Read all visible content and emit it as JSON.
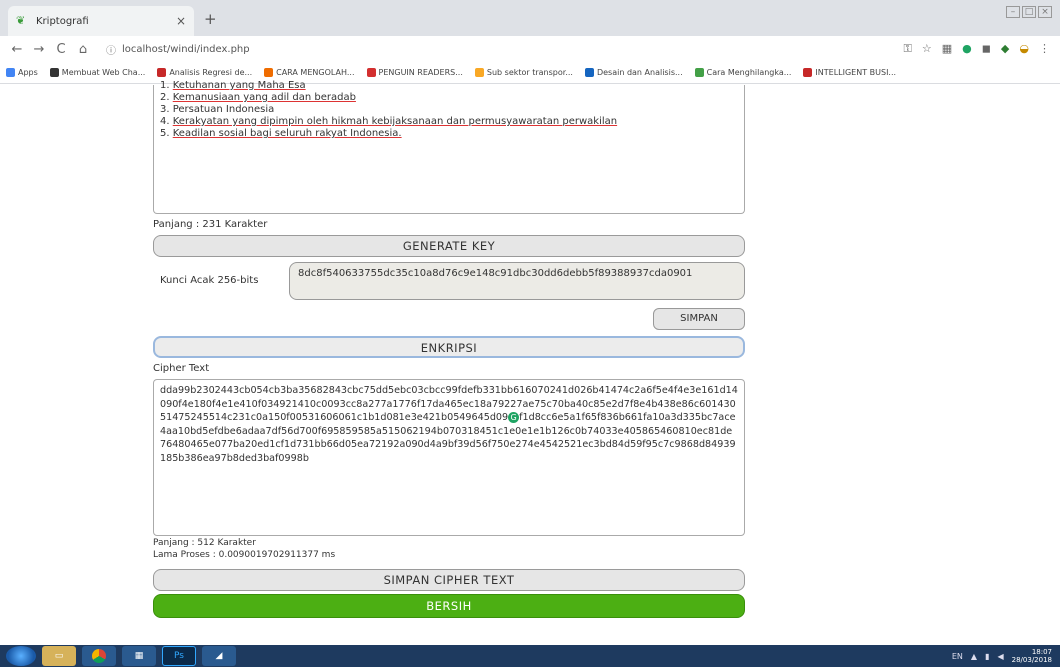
{
  "browser": {
    "tab_title": "Kriptografi",
    "tab_close": "×",
    "new_tab": "+",
    "url": "localhost/windi/index.php",
    "bookmarks": [
      {
        "label": "Apps",
        "color": "#4285f4"
      },
      {
        "label": "Membuat Web Cha...",
        "color": "#333333"
      },
      {
        "label": "Analisis Regresi de...",
        "color": "#c62828"
      },
      {
        "label": "CARA MENGOLAH...",
        "color": "#ef6c00"
      },
      {
        "label": "PENGUIN READERS...",
        "color": "#d32f2f"
      },
      {
        "label": "Sub sektor transpor...",
        "color": "#f9a825"
      },
      {
        "label": "Desain dan Analisis...",
        "color": "#1565c0"
      },
      {
        "label": "Cara Menghilangka...",
        "color": "#43a047"
      },
      {
        "label": "INTELLIGENT BUSI...",
        "color": "#c62828"
      }
    ]
  },
  "plaintext": {
    "lines": [
      {
        "prefix": "1. ",
        "text": "Ketuhanan yang Maha Esa"
      },
      {
        "prefix": "2. ",
        "text": "Kemanusiaan yang adil dan beradab"
      },
      {
        "prefix": "3. ",
        "text": "Persatuan Indonesia"
      },
      {
        "prefix": "4. ",
        "text": "Kerakyatan yang dipimpin oleh hikmah kebijaksanaan dan permusyawaratan perwakilan"
      },
      {
        "prefix": "5. ",
        "text": "Keadilan sosial bagi seluruh rakyat Indonesia."
      }
    ],
    "length_label": "Panjang : 231 Karakter"
  },
  "key": {
    "generate_label": "GENERATE KEY",
    "random_key_label": "Kunci Acak 256-bits",
    "value": "8dc8f540633755dc35c10a8d76c9e148c91dbc30dd6debb5f89388937cda0901",
    "save_label": "SIMPAN"
  },
  "encrypt": {
    "button_label": "ENKRIPSI",
    "cipher_label": "Cipher Text",
    "cipher_value": "dda99b2302443cb054cb3ba35682843cbc75dd5ebc03cbcc99fdefb331bb616070241d026b41474c2a6f5e4f4e3e161d14090f4e180f4e1e410f034921410c0093cc8a277a1776f17da465ec18a79227ae75c70ba40c85e2d7f8e4b438e86c60143051475245514c231c0a150f00531606061c1b1d081e3e421b0549645d09",
    "cipher_value_tail": "f1d8cc6e5a1f65f836b661fa10a3d335bc7ace4aa10bd5efdbe6adaa7df56d700f695859585a515062194b070318451c1e0e1e1b126c0b74033e405865460810ec81de76480465e077ba20ed1cf1d731bb66d05ea72192a090d4a9bf39d56f750e274e4542521ec3bd84d59f95c7c9868d84939185b386ea97b8ded3baf0998b",
    "badge": "G",
    "length_label": "Panjang : 512 Karakter",
    "time_label": "Lama Proses : 0.0090019702911377 ms",
    "save_cipher_label": "SIMPAN CIPHER TEXT",
    "clear_label": "BERSIH"
  },
  "taskbar": {
    "lang": "EN",
    "time": "18:07",
    "date": "28/03/2018"
  },
  "colors": {
    "clear_button": "#4caf13",
    "encrypt_border": "#9ab8de",
    "taskbar": "#1e3a5f"
  }
}
